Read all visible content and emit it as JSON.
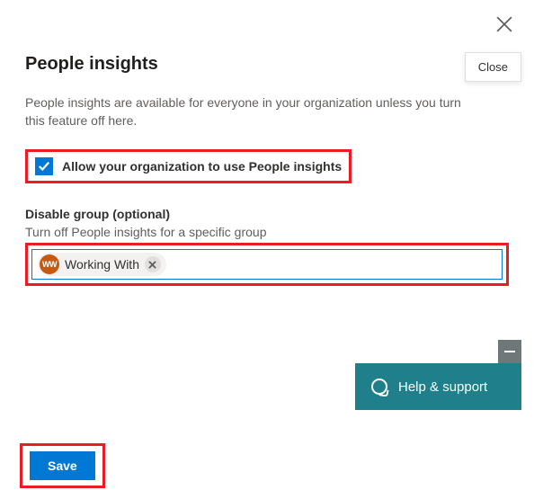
{
  "header": {
    "title": "People insights",
    "close_tooltip": "Close"
  },
  "description": "People insights are available for everyone in your organization unless you turn this feature off here.",
  "allow_checkbox": {
    "checked": true,
    "label": "Allow your organization to use People insights"
  },
  "disable_group": {
    "label": "Disable group (optional)",
    "sublabel": "Turn off People insights for a specific group",
    "chips": [
      {
        "initials": "WW",
        "name": "Working With"
      }
    ]
  },
  "help_support": {
    "label": "Help & support"
  },
  "footer": {
    "save_label": "Save"
  },
  "colors": {
    "primary": "#0078d4",
    "highlight_border": "#ec1c24",
    "help_bg": "#1f7f8b",
    "chip_avatar": "#c65a11"
  }
}
